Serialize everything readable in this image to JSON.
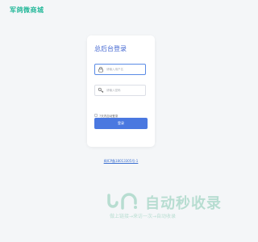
{
  "brand": {
    "name": "军鸽微商城",
    "color": "#27b99b"
  },
  "login": {
    "title": "总后台登录",
    "username_placeholder": "请输入用户名",
    "password_placeholder": "请输入密码",
    "remember_label": "7天内自动登录",
    "submit_label": "登录",
    "accent_color": "#4a78e0"
  },
  "footer": {
    "icp_text": "闽ICP备18013305号-1"
  },
  "watermark": {
    "title": "自动秒收录",
    "subtitle": "做上链接→来访一次→自动收录",
    "color": "#1e9e6e"
  }
}
